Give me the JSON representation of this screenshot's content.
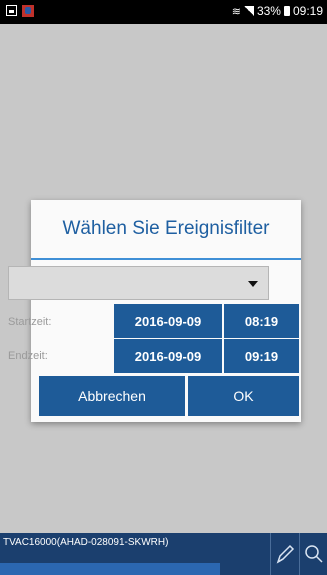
{
  "status_bar": {
    "battery": "33%",
    "time": "09:19"
  },
  "dialog": {
    "title": "Wählen Sie Ereignisfilter",
    "dropdown_value": "",
    "start_label": "Startzeit:",
    "start_date": "2016-09-09",
    "start_time": "08:19",
    "end_label": "Endzeit:",
    "end_date": "2016-09-09",
    "end_time": "09:19",
    "cancel_label": "Abbrechen",
    "ok_label": "OK"
  },
  "bottom_bar": {
    "device_name": "TVAC16000(AHAD-028091-SKWRH)"
  },
  "icons": {
    "edit": "pencil-icon",
    "search": "search-icon"
  }
}
